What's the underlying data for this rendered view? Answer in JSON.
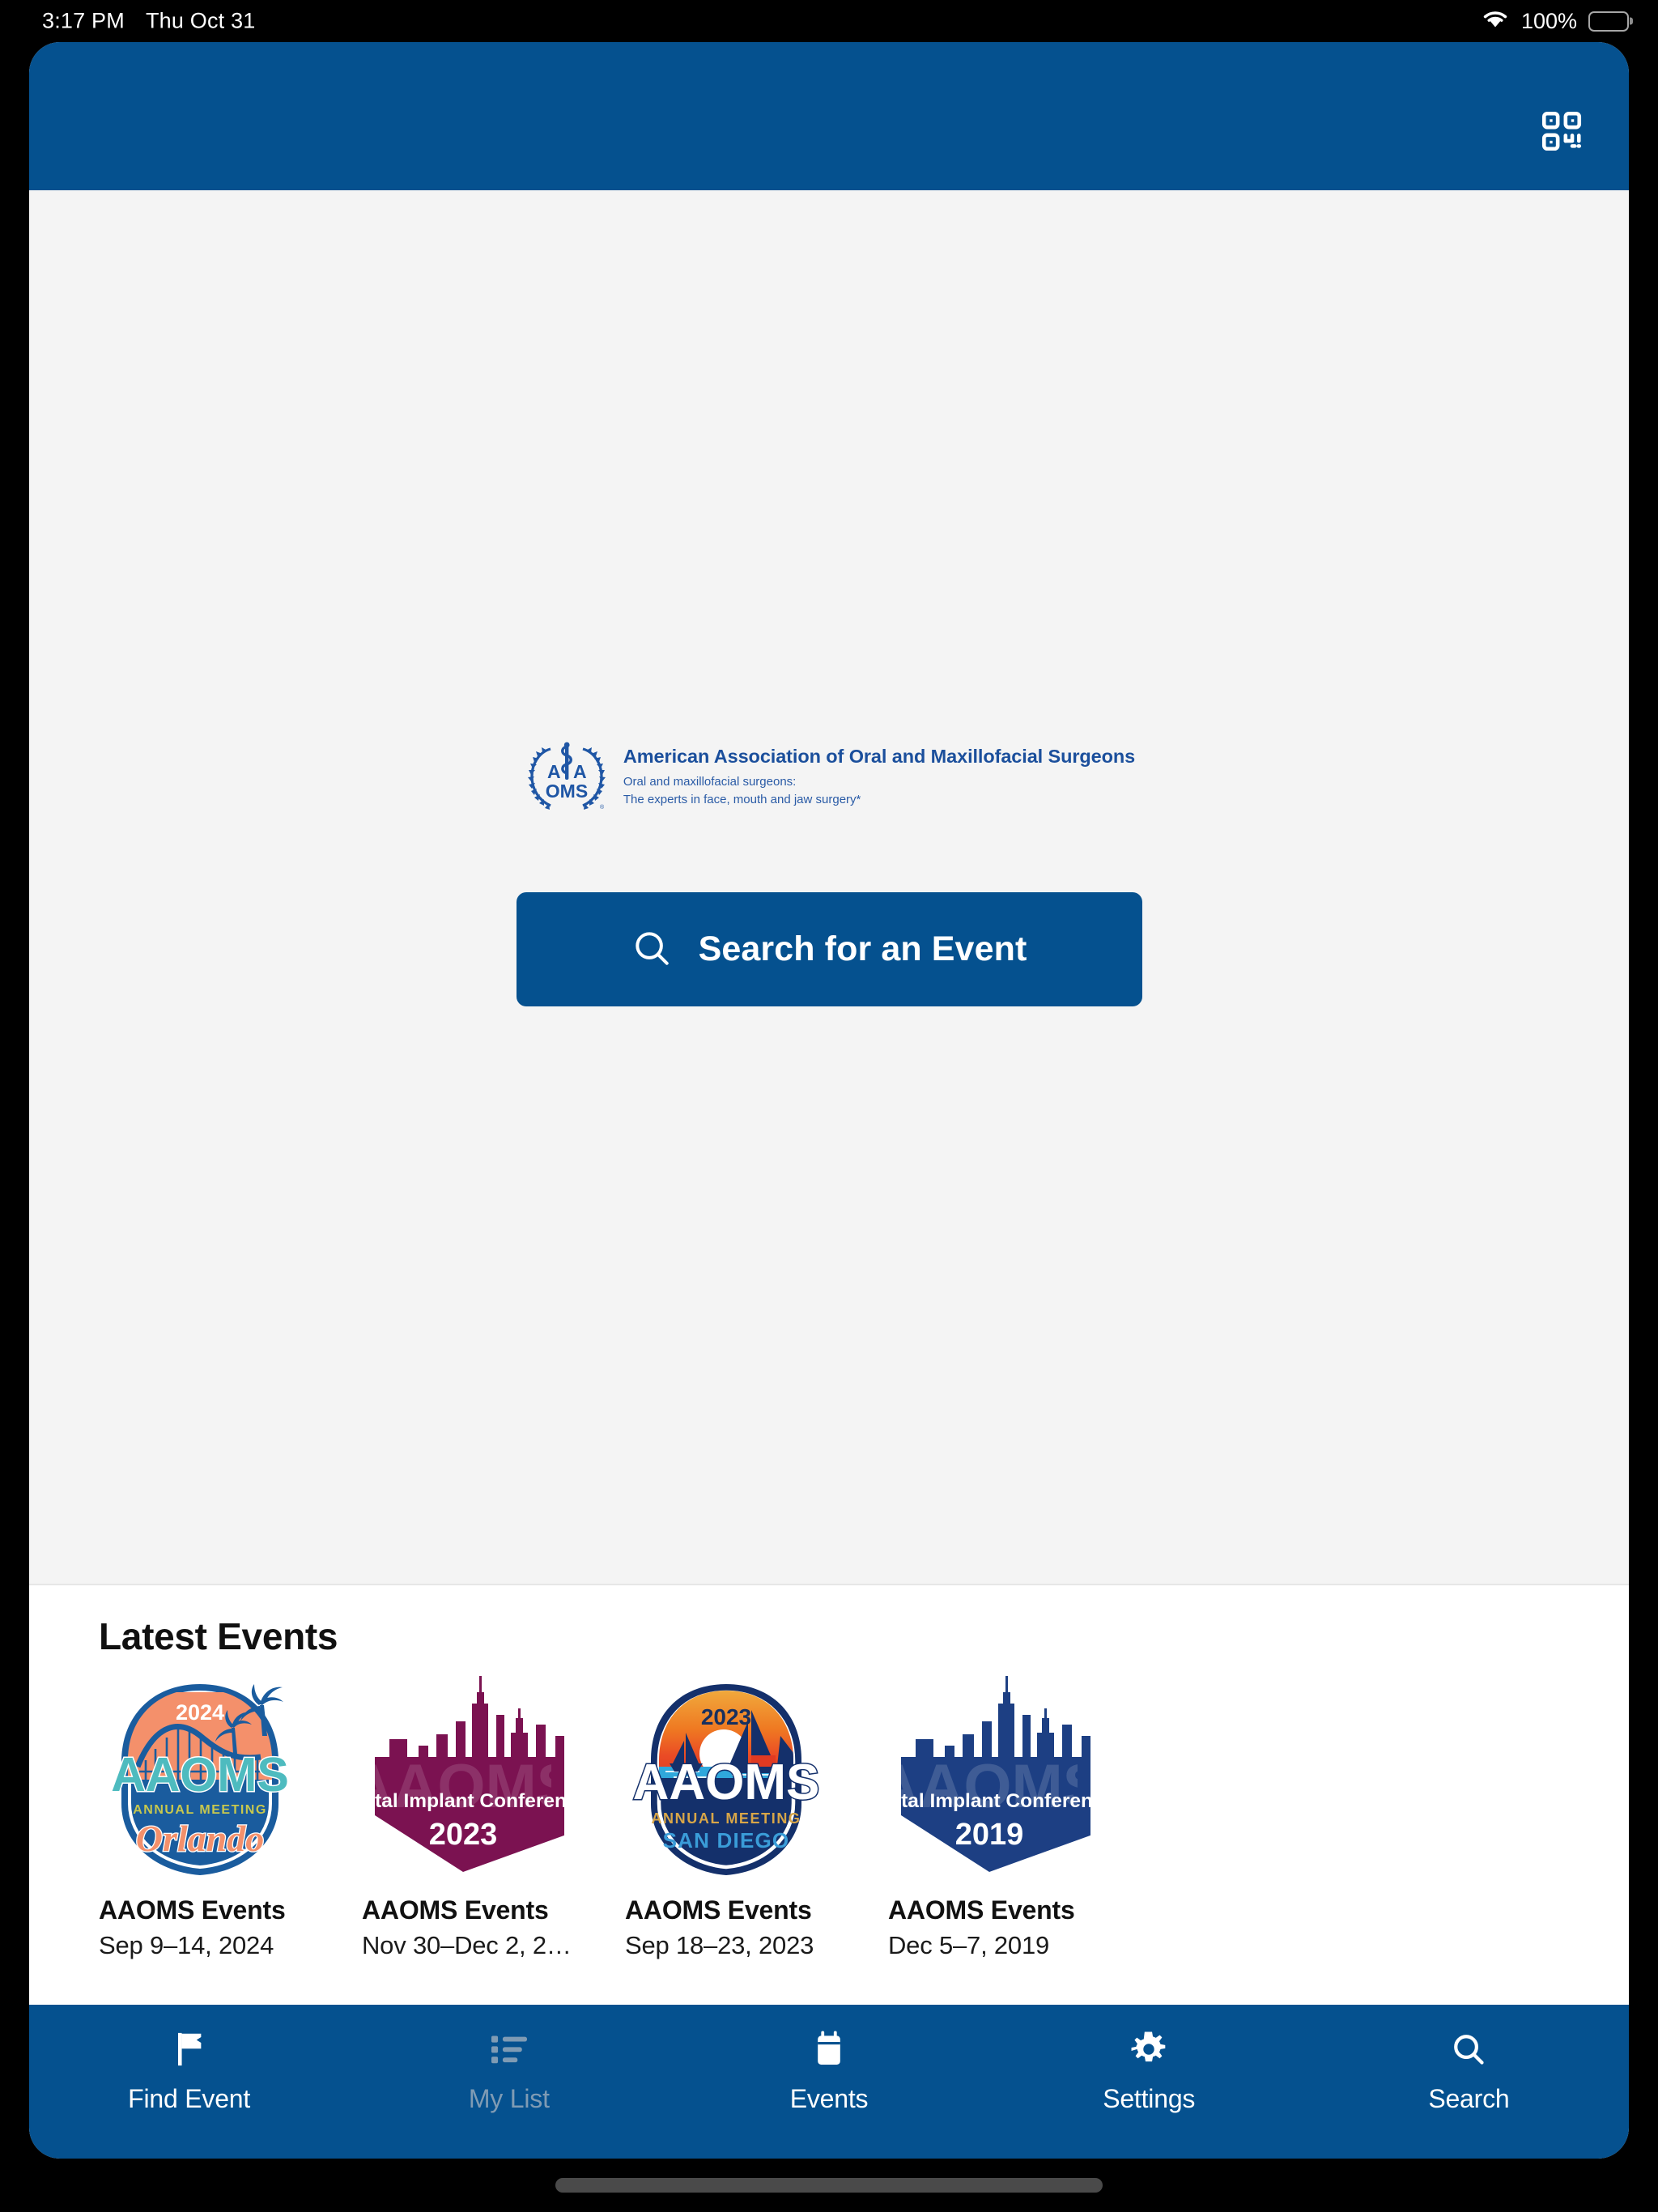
{
  "status_bar": {
    "time": "3:17 PM",
    "date": "Thu Oct 31",
    "battery_percent": "100%",
    "wifi_icon": "wifi-icon",
    "battery_icon": "battery-full-icon"
  },
  "header": {
    "background_color": "#05518f",
    "qr_icon": "qr-code-scan-icon"
  },
  "hero": {
    "logo": {
      "emblem_icon": "aaoms-caduceus-laurel-emblem",
      "organization": "American Association of Oral and Maxillofacial Surgeons",
      "tagline_line1": "Oral and maxillofacial surgeons:",
      "tagline_line2": "The experts in face, mouth and jaw surgery*",
      "brand_color": "#1b4f9c"
    },
    "search_button": {
      "label": "Search for an Event",
      "icon": "search-icon",
      "background_color": "#05518f"
    }
  },
  "latest_events": {
    "title": "Latest Events",
    "cards": [
      {
        "art_name": "aaoms-annual-meeting-orlando-2024-badge",
        "year": "2024",
        "badge_text": "AAOMS",
        "badge_sub": "ANNUAL MEETING",
        "badge_city": "Orlando",
        "title": "AAOMS Events",
        "date": "Sep 9–14, 2024",
        "accent_color": "#f08a62"
      },
      {
        "art_name": "aaoms-dental-implant-conference-2023-badge",
        "year": "2023",
        "badge_text": "Dental Implant Conference",
        "badge_watermark": "AAOMS",
        "title": "AAOMS Events",
        "date": "Nov 30–Dec 2, 2…",
        "accent_color": "#7b1251"
      },
      {
        "art_name": "aaoms-annual-meeting-san-diego-2023-badge",
        "year": "2023",
        "badge_text": "AAOMS",
        "badge_sub": "ANNUAL MEETING",
        "badge_city": "SAN DIEGO",
        "title": "AAOMS Events",
        "date": "Sep 18–23, 2023",
        "accent_color": "#ef6024"
      },
      {
        "art_name": "aaoms-dental-implant-conference-2019-badge",
        "year": "2019",
        "badge_text": "Dental Implant Conference",
        "badge_watermark": "AAOMS",
        "title": "AAOMS Events",
        "date": "Dec 5–7, 2019",
        "accent_color": "#1d3f83"
      }
    ]
  },
  "tab_bar": {
    "background_color": "#05518f",
    "items": [
      {
        "label": "Find Event",
        "icon": "flag-icon",
        "state": "enabled"
      },
      {
        "label": "My List",
        "icon": "list-icon",
        "state": "disabled"
      },
      {
        "label": "Events",
        "icon": "calendar-icon",
        "state": "enabled"
      },
      {
        "label": "Settings",
        "icon": "gear-icon",
        "state": "enabled"
      },
      {
        "label": "Search",
        "icon": "search-icon",
        "state": "enabled"
      }
    ]
  }
}
